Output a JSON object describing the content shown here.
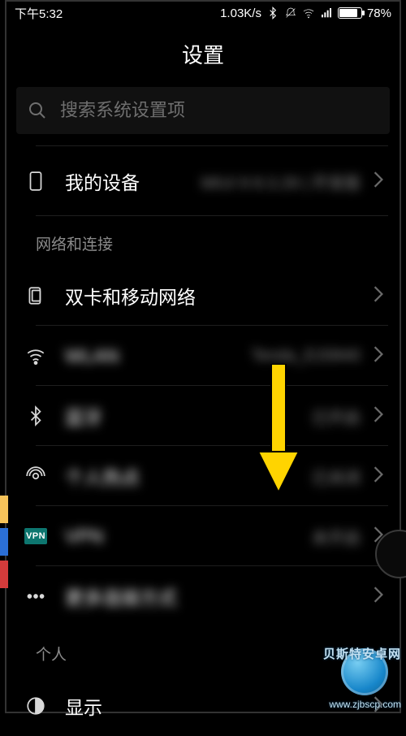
{
  "status": {
    "time": "下午5:32",
    "net_speed": "1.03K/s",
    "battery_pct": "78%"
  },
  "header": {
    "title": "设置"
  },
  "search": {
    "placeholder": "搜索系统设置项"
  },
  "sections": {
    "device": {
      "label": "我的设备",
      "value": "MIUI 9 8.3.29 | 开发版"
    },
    "network_header": "网络和连接",
    "sim": {
      "label": "双卡和移动网络"
    },
    "wlan": {
      "label": "WLAN",
      "value": "Tenda_E20840"
    },
    "bluetooth": {
      "label": "蓝牙",
      "value": "已开启"
    },
    "hotspot": {
      "label": "个人热点",
      "value": "已关闭"
    },
    "vpn": {
      "label": "VPN",
      "value": "未开启",
      "badge": "VPN"
    },
    "more": {
      "label": "更多连接方式"
    },
    "personal_header": "个人",
    "display": {
      "label": "显示"
    }
  },
  "watermark": {
    "line1": "贝斯特安卓网",
    "line2": "www.zjbscp.com"
  }
}
